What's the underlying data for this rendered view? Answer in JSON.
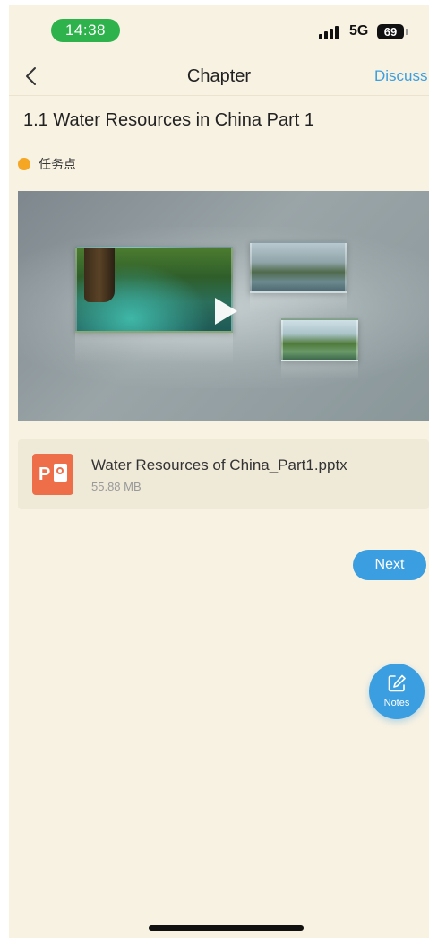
{
  "status_bar": {
    "time": "14:38",
    "network": "5G",
    "battery": "69"
  },
  "header": {
    "title": "Chapter",
    "discuss_label": "Discuss"
  },
  "page": {
    "title": "1.1 Water Resources in China Part 1",
    "task_point_label": "任务点"
  },
  "attachment": {
    "file_name": "Water Resources of China_Part1.pptx",
    "file_size": "55.88 MB",
    "icon_letter": "P"
  },
  "actions": {
    "next_label": "Next",
    "notes_label": "Notes"
  },
  "colors": {
    "accent": "#3a9ee0",
    "task_dot": "#f5a623",
    "time_pill": "#2eb24c",
    "ppt_icon": "#ee6e4a",
    "background": "#f8f2e3"
  },
  "icons": {
    "back": "chevron-left-icon",
    "play": "play-icon",
    "notes": "edit-note-icon",
    "file": "powerpoint-file-icon"
  }
}
